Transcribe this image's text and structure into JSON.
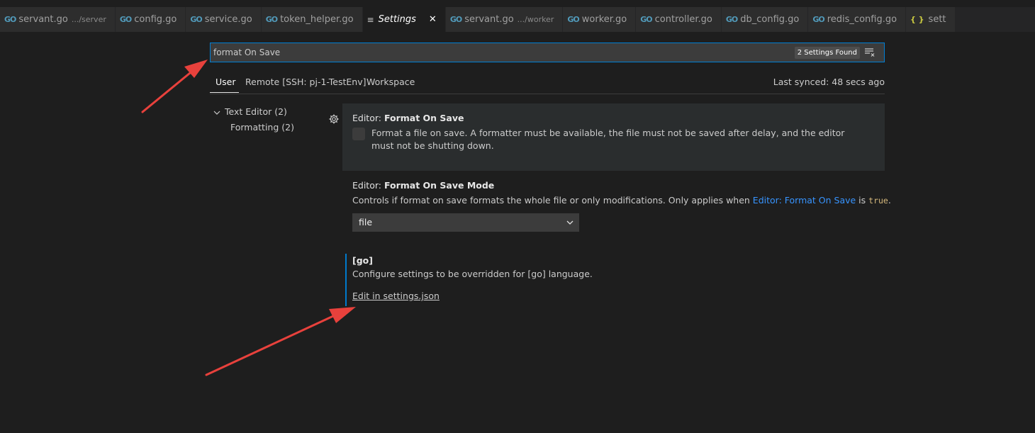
{
  "tabs": [
    {
      "icon": "go-icon",
      "label": "servant.go",
      "desc": ".../server",
      "active": false
    },
    {
      "icon": "go-icon",
      "label": "config.go",
      "desc": "",
      "active": false
    },
    {
      "icon": "go-icon",
      "label": "service.go",
      "desc": "",
      "active": false
    },
    {
      "icon": "go-icon",
      "label": "token_helper.go",
      "desc": "",
      "active": false
    },
    {
      "icon": "settings-icon",
      "label": "Settings",
      "desc": "",
      "active": true
    },
    {
      "icon": "go-icon",
      "label": "servant.go",
      "desc": ".../worker",
      "active": false
    },
    {
      "icon": "go-icon",
      "label": "worker.go",
      "desc": "",
      "active": false
    },
    {
      "icon": "go-icon",
      "label": "controller.go",
      "desc": "",
      "active": false
    },
    {
      "icon": "go-icon",
      "label": "db_config.go",
      "desc": "",
      "active": false
    },
    {
      "icon": "go-icon",
      "label": "redis_config.go",
      "desc": "",
      "active": false
    },
    {
      "icon": "json-icon",
      "label": "sett",
      "desc": "",
      "active": false
    }
  ],
  "icons": {
    "go": "GO",
    "json": "{ }",
    "settings": "≡",
    "close": "✕"
  },
  "search": {
    "value": "format On Save",
    "found": "2 Settings Found"
  },
  "scope": {
    "user": "User",
    "remote": "Remote [SSH: pj-1-TestEnv]",
    "workspace": "Workspace",
    "last_synced": "Last synced: 48 secs ago"
  },
  "toc": {
    "text_editor": "Text Editor (2)",
    "formatting": "Formatting (2)"
  },
  "settings": {
    "format_on_save": {
      "category": "Editor: ",
      "name": "Format On Save",
      "description": "Format a file on save. A formatter must be available, the file must not be saved after delay, and the editor must not be shutting down.",
      "checked": false
    },
    "format_on_save_mode": {
      "category": "Editor: ",
      "name": "Format On Save Mode",
      "desc_before": "Controls if format on save formats the whole file or only modifications. Only applies when ",
      "desc_link": "Editor: Format On Save",
      "desc_mid": " is ",
      "desc_code": "true",
      "desc_after": ".",
      "value": "file"
    },
    "go_override": {
      "title": "[go]",
      "description": "Configure settings to be overridden for [go] language.",
      "edit_link": "Edit in settings.json"
    }
  },
  "colors": {
    "accent": "#007acc",
    "focus_border": "#007fd4",
    "link": "#3794ff",
    "annotation_arrow": "#e8413c"
  }
}
